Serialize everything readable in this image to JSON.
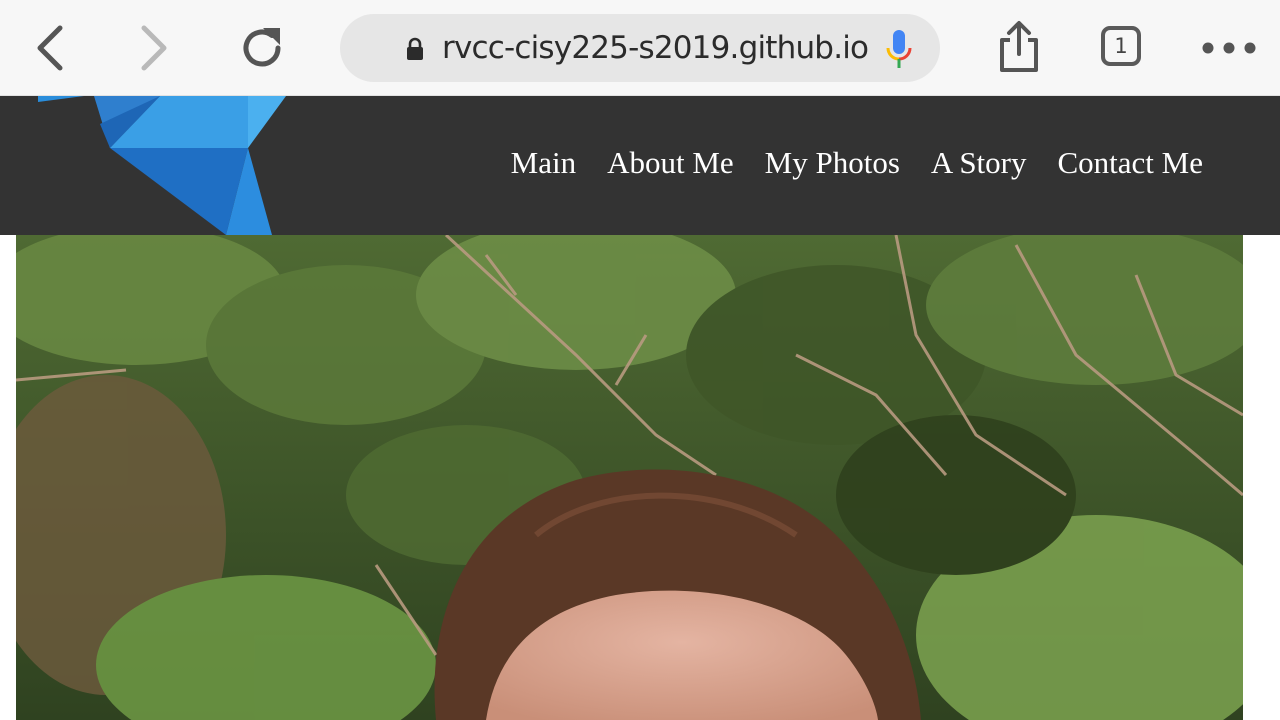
{
  "browser": {
    "url": "rvcc-cisy225-s2019.github.io",
    "tab_count": "1",
    "icons": {
      "back": "chevron-left-icon",
      "forward": "chevron-right-icon",
      "reload": "reload-icon",
      "lock": "lock-icon",
      "mic": "microphone-icon",
      "share": "share-icon",
      "tabs": "tabs-icon",
      "more": "more-icon"
    }
  },
  "site": {
    "header_color": "#333333",
    "logo": "blue-geometric-bird-logo",
    "nav": [
      {
        "label": "Main"
      },
      {
        "label": "About Me"
      },
      {
        "label": "My Photos"
      },
      {
        "label": "A Story"
      },
      {
        "label": "Contact Me"
      }
    ]
  },
  "content": {
    "photo": "portrait-photo-outdoors-pine-trees"
  }
}
